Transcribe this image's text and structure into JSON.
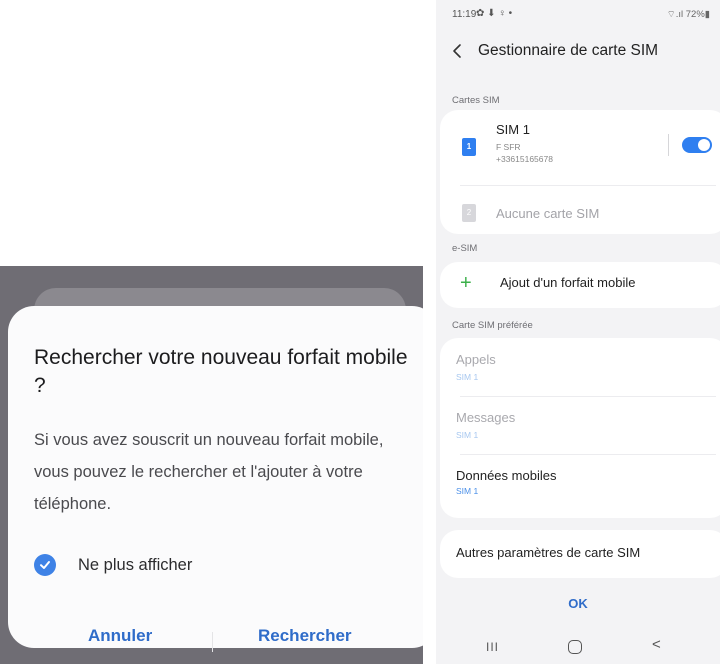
{
  "dialog": {
    "title": "Rechercher votre nouveau forfait mobile ?",
    "body": "Si vous avez souscrit un nouveau forfait mobile, vous pouvez le rechercher et l'ajouter à votre téléphone.",
    "checkbox_label": "Ne plus afficher",
    "checkbox_checked": true,
    "cancel_label": "Annuler",
    "confirm_label": "Rechercher"
  },
  "phone": {
    "status": {
      "time": "11:19",
      "icons": "✿ ⬇ ♀ •",
      "right": "⌔.ıl 72%▮"
    },
    "title": "Gestionnaire de carte SIM",
    "sections": {
      "sim_cards": "Cartes SIM",
      "esim": "e-SIM",
      "preferred": "Carte SIM préférée"
    },
    "sim1": {
      "icon_text": "1",
      "name": "SIM 1",
      "operator": "F SFR",
      "number": "+33615165678",
      "enabled": true
    },
    "sim2": {
      "icon_text": "2",
      "label": "Aucune carte SIM"
    },
    "esim_add_label": "Ajout d'un forfait mobile",
    "preferred": {
      "calls_label": "Appels",
      "calls_value": "SIM 1",
      "messages_label": "Messages",
      "messages_value": "SIM 1",
      "data_label": "Données mobiles",
      "data_value": "SIM 1"
    },
    "other_settings": "Autres paramètres de carte SIM",
    "ok_label": "OK",
    "nav": {
      "recent": "III",
      "back": "<"
    }
  },
  "colors": {
    "accent_blue": "#2f7ff0",
    "button_blue": "#2f6cc9",
    "plus_green": "#3cb04a"
  }
}
